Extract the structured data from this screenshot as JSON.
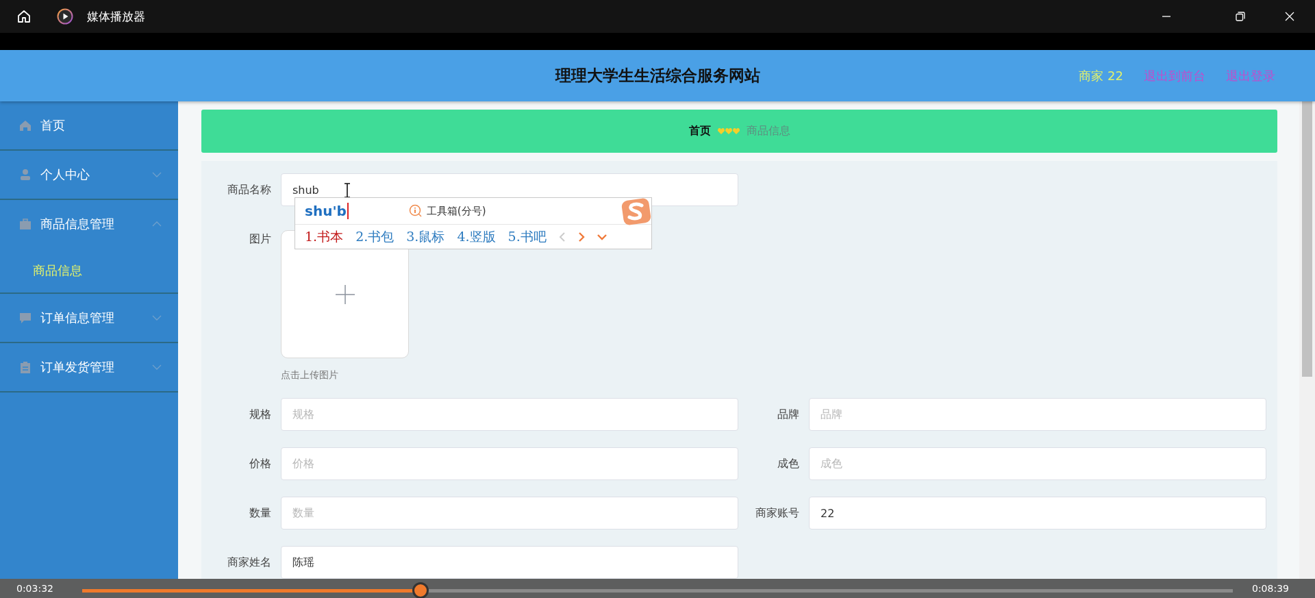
{
  "player": {
    "title": "媒体播放器",
    "elapsed": "0:03:32",
    "total": "0:08:39",
    "progress": {
      "level": 0.294
    }
  },
  "site": {
    "title": "理理大学生生活综合服务网站",
    "user": "商家 22",
    "links": [
      "退出到前台",
      "退出登录"
    ]
  },
  "sidebar": {
    "items": [
      {
        "label": "首页",
        "kind": "link"
      },
      {
        "label": "个人中心",
        "kind": "group",
        "expanded": false
      },
      {
        "label": "商品信息管理",
        "kind": "group",
        "expanded": true,
        "children": [
          {
            "label": "商品信息",
            "selected": true
          }
        ]
      },
      {
        "label": "订单信息管理",
        "kind": "group",
        "expanded": false
      },
      {
        "label": "订单发货管理",
        "kind": "group",
        "expanded": false
      }
    ]
  },
  "breadcrumb": {
    "home": "首页",
    "current": "商品信息"
  },
  "form": {
    "rows": [
      [
        {
          "label": "商品名称",
          "kind": "text",
          "value": "shub"
        }
      ],
      [
        {
          "label": "图片",
          "kind": "image",
          "hint": "点击上传图片"
        }
      ],
      [
        {
          "label": "规格",
          "kind": "text",
          "placeholder": "规格"
        },
        {
          "label": "品牌",
          "kind": "text",
          "placeholder": "品牌"
        }
      ],
      [
        {
          "label": "价格",
          "kind": "text",
          "placeholder": "价格"
        },
        {
          "label": "成色",
          "kind": "text",
          "placeholder": "成色"
        }
      ],
      [
        {
          "label": "数量",
          "kind": "text",
          "placeholder": "数量"
        },
        {
          "label": "商家账号",
          "kind": "text",
          "value": "22"
        }
      ],
      [
        {
          "label": "商家姓名",
          "kind": "text",
          "value": "陈瑶"
        }
      ]
    ]
  },
  "ime": {
    "composition": "shu'b",
    "tool": "工具箱(分号)",
    "candidates": [
      {
        "label": "1.书本",
        "selected": true
      },
      {
        "label": "2.书包",
        "selected": false
      },
      {
        "label": "3.鼠标",
        "selected": false
      },
      {
        "label": "4.竖版",
        "selected": false
      },
      {
        "label": "5.书吧",
        "selected": false
      }
    ]
  }
}
